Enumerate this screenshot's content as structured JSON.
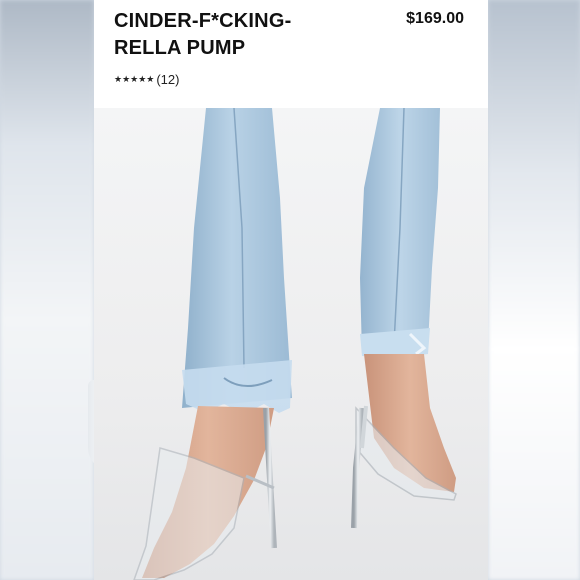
{
  "product": {
    "title_line1": "CINDER-F*CKING-",
    "title_line2": "RELLA PUMP",
    "price": "$169.00",
    "stars": "★★★★★",
    "review_count": "(12)"
  },
  "colors": {
    "denim": "#a9c6de",
    "denim_shadow": "#8fb0cb",
    "skin": "#d9a98e",
    "heel_silver": "#c9ced3"
  }
}
